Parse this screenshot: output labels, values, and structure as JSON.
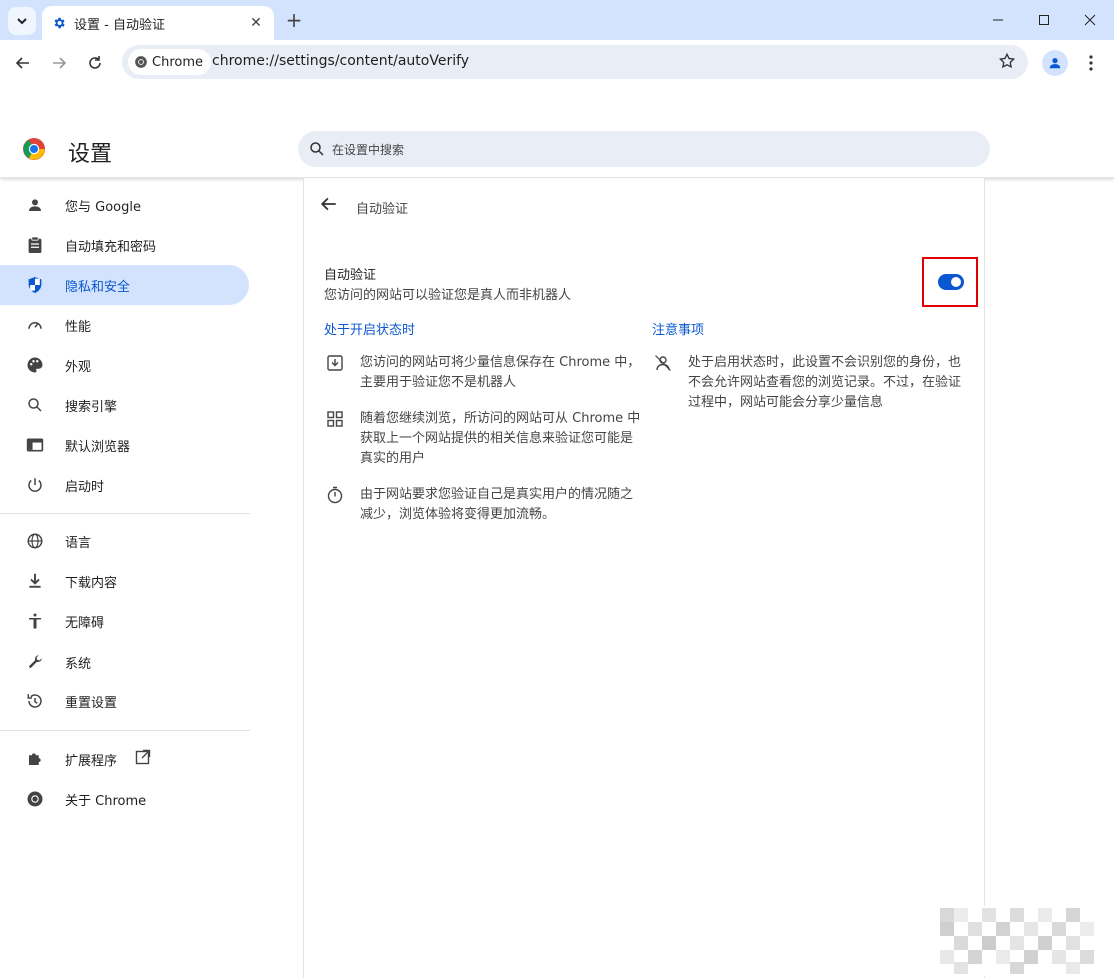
{
  "browser": {
    "tab_title": "设置 - 自动验证",
    "url_chip": "Chrome",
    "url": "chrome://settings/content/autoVerify"
  },
  "settings": {
    "title": "设置",
    "search_placeholder": "在设置中搜索"
  },
  "sidebar": {
    "items": [
      {
        "label": "您与 Google",
        "icon": "person-icon"
      },
      {
        "label": "自动填充和密码",
        "icon": "clipboard-icon"
      },
      {
        "label": "隐私和安全",
        "icon": "shield-icon",
        "active": true
      },
      {
        "label": "性能",
        "icon": "speedometer-icon"
      },
      {
        "label": "外观",
        "icon": "palette-icon"
      },
      {
        "label": "搜索引擎",
        "icon": "search-icon"
      },
      {
        "label": "默认浏览器",
        "icon": "browser-icon"
      },
      {
        "label": "启动时",
        "icon": "power-icon"
      },
      {
        "label": "语言",
        "icon": "globe-icon"
      },
      {
        "label": "下载内容",
        "icon": "download-icon"
      },
      {
        "label": "无障碍",
        "icon": "accessibility-icon"
      },
      {
        "label": "系统",
        "icon": "wrench-icon"
      },
      {
        "label": "重置设置",
        "icon": "history-icon"
      },
      {
        "label": "扩展程序",
        "icon": "puzzle-icon"
      },
      {
        "label": "关于 Chrome",
        "icon": "chrome-icon"
      }
    ]
  },
  "main": {
    "page_title": "自动验证",
    "setting_title": "自动验证",
    "setting_desc": "您访问的网站可以验证您是真人而非机器人",
    "toggle_on": true,
    "left_heading": "处于开启状态时",
    "right_heading": "注意事项",
    "left_bullets": [
      {
        "icon": "save-box-icon",
        "lines": [
          "您访问的网站可将少量信息保存在 Chrome 中，",
          "主要用于验证您不是机器人"
        ]
      },
      {
        "icon": "grid-icon",
        "lines": [
          "随着您继续浏览，所访问的网站可从 Chrome 中",
          "获取上一个网站提供的相关信息来验证您可能是",
          "真实的用户"
        ]
      },
      {
        "icon": "timer-icon",
        "lines": [
          "由于网站要求您验证自己是真实用户的情况随之",
          "减少，浏览体验将变得更加流畅。"
        ]
      }
    ],
    "right_bullets": [
      {
        "icon": "incognito-icon",
        "lines": [
          "处于启用状态时，此设置不会识别您的身份，也",
          "不会允许网站查看您的浏览记录。不过，在验证",
          "过程中，网站可能会分享少量信息"
        ]
      }
    ]
  },
  "colors": {
    "accent": "#0b57d0",
    "tabstrip": "#d3e3fd",
    "highlight_box": "#e00000"
  }
}
